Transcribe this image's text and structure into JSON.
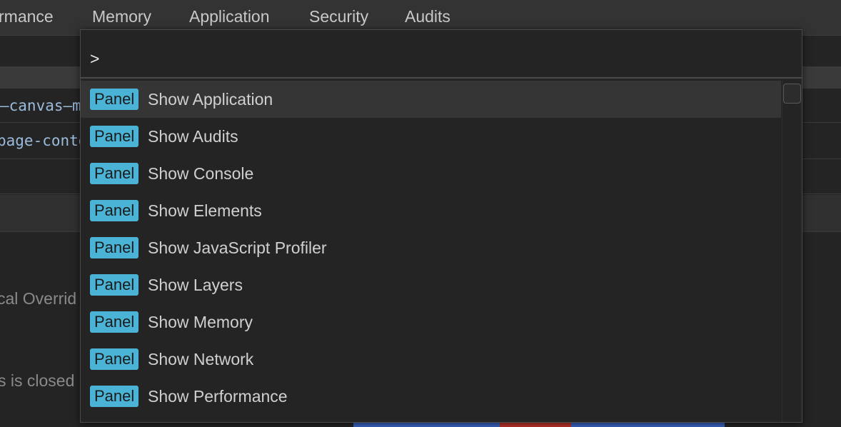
{
  "tabs": {
    "performance": "rmance",
    "memory": "Memory",
    "application": "Application",
    "security": "Security",
    "audits": "Audits"
  },
  "background": {
    "code_line_1": "–canvas–m",
    "code_line_2": "page-conte",
    "text_line_1": "cal Overrid",
    "text_line_2": "s is closed"
  },
  "command_menu": {
    "input_value": ">",
    "items": [
      {
        "badge": "Panel",
        "label": "Show Application"
      },
      {
        "badge": "Panel",
        "label": "Show Audits"
      },
      {
        "badge": "Panel",
        "label": "Show Console"
      },
      {
        "badge": "Panel",
        "label": "Show Elements"
      },
      {
        "badge": "Panel",
        "label": "Show JavaScript Profiler"
      },
      {
        "badge": "Panel",
        "label": "Show Layers"
      },
      {
        "badge": "Panel",
        "label": "Show Memory"
      },
      {
        "badge": "Panel",
        "label": "Show Network"
      },
      {
        "badge": "Panel",
        "label": "Show Performance"
      }
    ]
  },
  "colors": {
    "badge_bg": "#4ab3d6",
    "selected_row_bg": "#353535",
    "tabbar_bg": "#333333",
    "strip_blue": "#3a67c9",
    "strip_red": "#c5352b"
  }
}
